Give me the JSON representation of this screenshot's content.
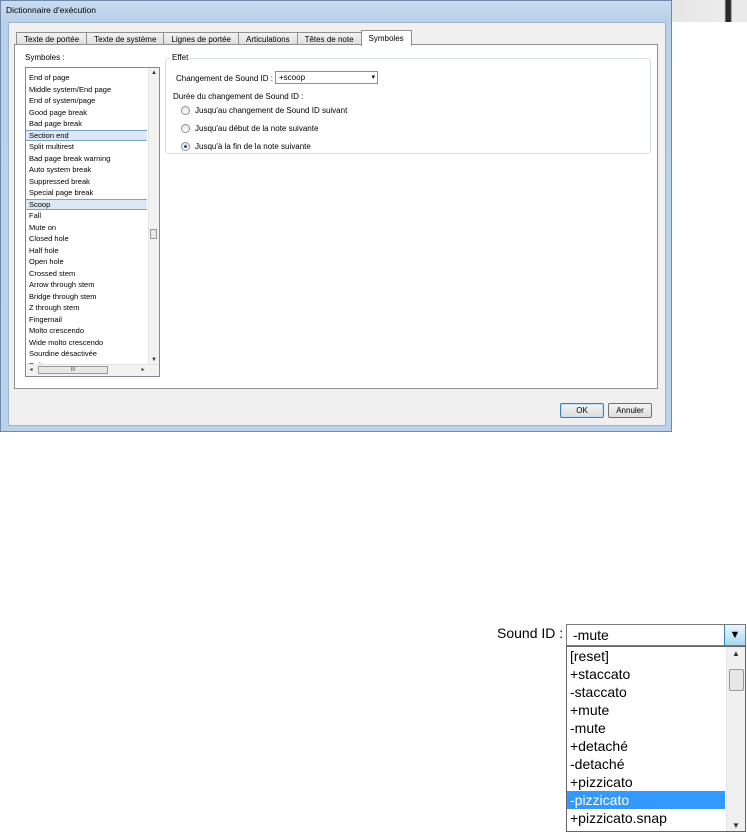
{
  "window": {
    "title": "Dictionnaire d'exécution"
  },
  "tabs": [
    {
      "label": "Texte de portée"
    },
    {
      "label": "Texte de système"
    },
    {
      "label": "Lignes de portée"
    },
    {
      "label": "Articulations"
    },
    {
      "label": "Têtes de note"
    },
    {
      "label": "Symboles",
      "active": true
    }
  ],
  "symbols": {
    "label": "Symboles :",
    "selected": "Scoop",
    "items": [
      "End of page",
      "Middle system/End page",
      "End of system/page",
      "Good page break",
      "Bad page break",
      "Section end",
      "Split multirest",
      "Bad page break warning",
      "Auto system break",
      "Suppressed break",
      "Special page break",
      "Scoop",
      "Fall",
      "Mute on",
      "Closed hole",
      "Half hole",
      "Open hole",
      "Crossed stem",
      "Arrow through stem",
      "Bridge through stem",
      "Z through stem",
      "Fingernail",
      "Molto crescendo",
      "Wide molto crescendo",
      "Sourdine désactivée",
      "Doit"
    ],
    "hscroll_grip": "III"
  },
  "effect": {
    "legend": "Effet",
    "sound_id_label": "Changement de Sound ID :",
    "sound_id_value": "+scoop",
    "duration_label": "Durée du changement de Sound ID :",
    "options": [
      {
        "label": "Jusqu'au changement de Sound ID suivant",
        "checked": false
      },
      {
        "label": "Jusqu'au début de la note suivante",
        "checked": false
      },
      {
        "label": "Jusqu'à la fin de la note suivante",
        "checked": true
      }
    ]
  },
  "buttons": {
    "ok": "OK",
    "cancel": "Annuler"
  },
  "zoom": {
    "label": "Sound ID :",
    "value": "-mute",
    "selected": "-pizzicato",
    "items": [
      "[reset]",
      "+staccato",
      "-staccato",
      "+mute",
      "-mute",
      "+detaché",
      "-detaché",
      "+pizzicato",
      "-pizzicato",
      "+pizzicato.snap"
    ]
  },
  "icons": {
    "up": "▲",
    "down": "▼",
    "left": "◂",
    "right": "▸",
    "dropdown": "▾"
  }
}
